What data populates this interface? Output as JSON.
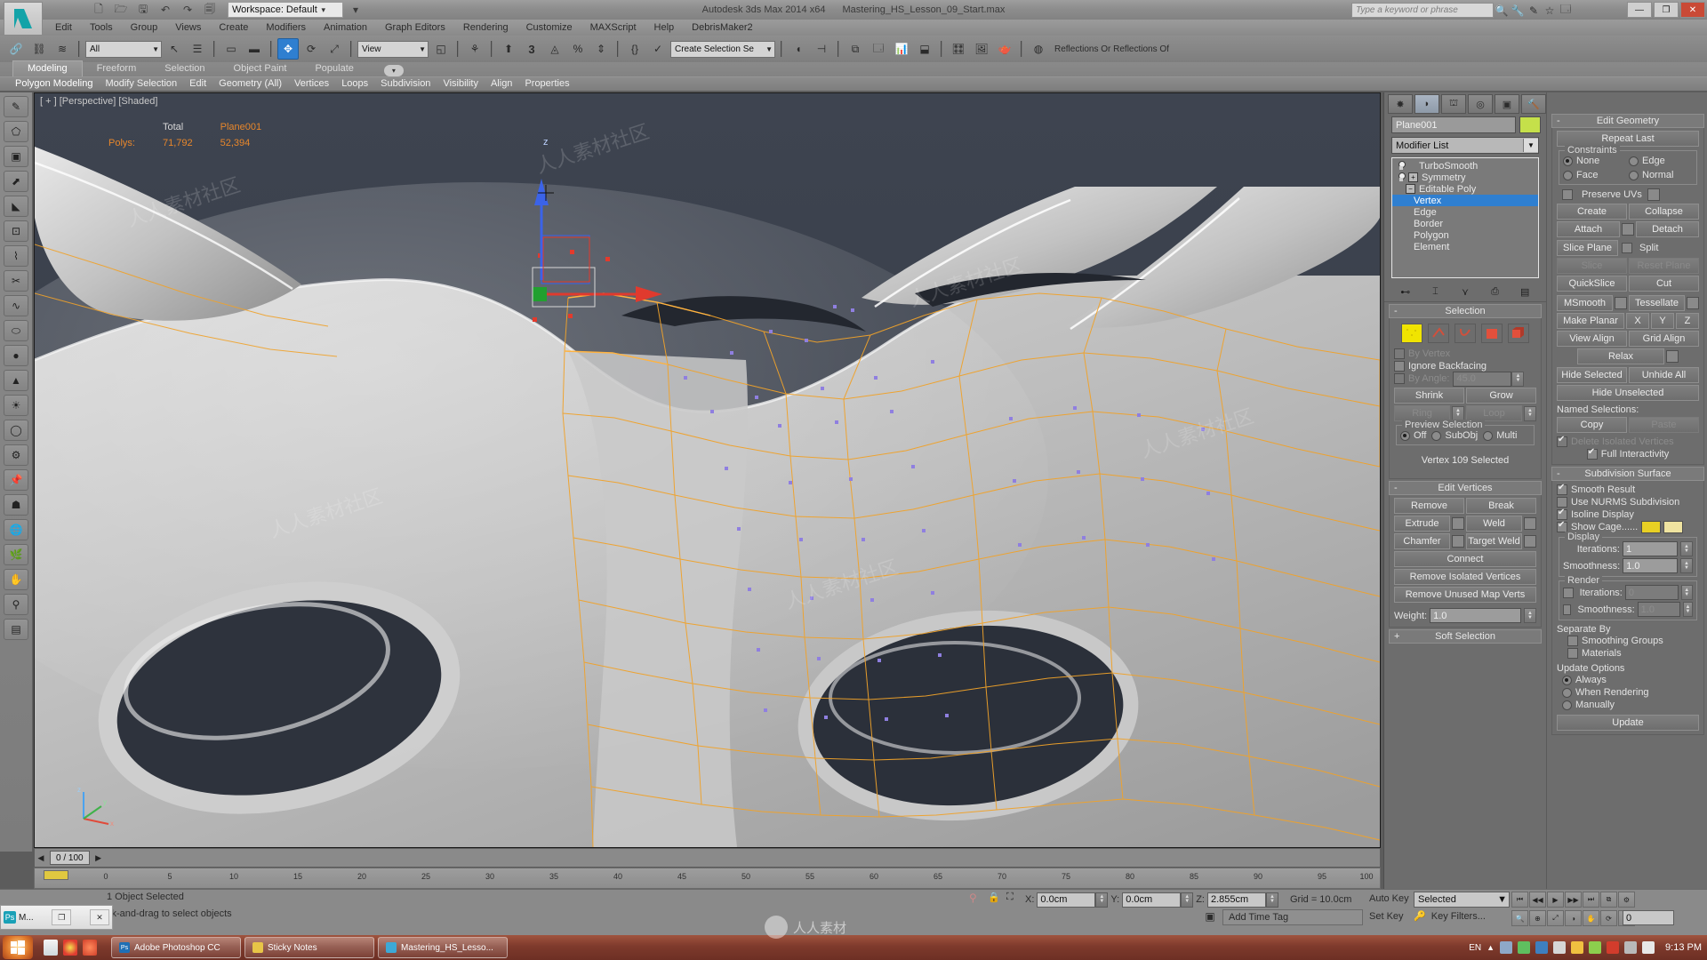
{
  "titlebar": {
    "workspace": "Workspace: Default",
    "app_title": "Autodesk 3ds Max  2014 x64",
    "file_title": "Mastering_HS_Lesson_09_Start.max",
    "search_placeholder": "Type a keyword or phrase",
    "quick_access": [
      "new-icon",
      "open-icon",
      "save-icon",
      "undo-icon",
      "redo-icon",
      "setproject-icon"
    ],
    "title_icons": [
      "binoculars-icon",
      "wrench-icon",
      "pen-icon",
      "star-icon",
      "help-icon"
    ],
    "window_buttons": [
      "minimize",
      "restore",
      "close"
    ],
    "minimize_glyph": "—",
    "restore_glyph": "❐",
    "close_glyph": "✕"
  },
  "menubar": {
    "items": [
      "Edit",
      "Tools",
      "Group",
      "Views",
      "Create",
      "Modifiers",
      "Animation",
      "Graph Editors",
      "Rendering",
      "Customize",
      "MAXScript",
      "Help",
      "DebrisMaker2"
    ]
  },
  "toolbar": {
    "selection_filter": "All",
    "reference_coord": "View",
    "named_selection_sets": "Create Selection Se",
    "snaps_percent": "3",
    "reflections_label": "Reflections Or Reflections Of",
    "icons": [
      "undo-icon",
      "redo-icon",
      "select-link-icon",
      "unlink-icon",
      "bind-spacewarp-icon",
      "select-object-icon",
      "select-by-name-icon",
      "rect-select-region-icon",
      "window-crossing-icon",
      "select-and-move-icon",
      "select-and-rotate-icon",
      "select-and-scale-icon",
      "mirror-icon",
      "align-icon",
      "snap-toggle-icon",
      "angle-snap-icon",
      "percent-snap-icon",
      "spinner-snap-icon",
      "named-selection-icon",
      "curve-editor-icon",
      "schematic-view-icon",
      "material-editor-icon",
      "render-setup-icon",
      "render-frame-window-icon",
      "render-production-icon",
      "render-iterative-icon",
      "activeshade-icon"
    ]
  },
  "ribbon": {
    "tabs": [
      {
        "label": "Modeling",
        "active": true
      },
      {
        "label": "Freeform",
        "active": false
      },
      {
        "label": "Selection",
        "active": false
      },
      {
        "label": "Object Paint",
        "active": false
      },
      {
        "label": "Populate",
        "active": false
      }
    ],
    "subtabs": [
      {
        "label": "Polygon Modeling",
        "active": true
      },
      {
        "label": "Modify Selection",
        "active": false
      },
      {
        "label": "Edit",
        "active": false
      },
      {
        "label": "Geometry (All)",
        "active": false
      },
      {
        "label": "Vertices",
        "active": false
      },
      {
        "label": "Loops",
        "active": false
      },
      {
        "label": "Subdivision",
        "active": false
      },
      {
        "label": "Visibility",
        "active": false
      },
      {
        "label": "Align",
        "active": false
      },
      {
        "label": "Properties",
        "active": false
      }
    ]
  },
  "viewport": {
    "label": "[ + ] [Perspective] [Shaded]",
    "stats": {
      "col_headers": [
        "Total",
        "Plane001"
      ],
      "rows": [
        {
          "name": "Polys:",
          "total": "71,792",
          "object": "52,394"
        }
      ]
    },
    "axis_labels": {
      "x": "x",
      "y": "y",
      "z": "z"
    },
    "gizmo_z_label": "z"
  },
  "command_panel": {
    "tabs": [
      "create-tab",
      "modify-tab",
      "hierarchy-tab",
      "motion-tab",
      "display-tab",
      "utilities-tab"
    ],
    "object_name": "Plane001",
    "object_color": "#c5e04a",
    "modifier_list_label": "Modifier List",
    "stack": [
      {
        "label": "TurboSmooth",
        "type": "modifier",
        "bulb": true,
        "expandable": false,
        "selected": false
      },
      {
        "label": "Symmetry",
        "type": "modifier",
        "bulb": true,
        "expandable": true,
        "selected": false
      },
      {
        "label": "Editable Poly",
        "type": "base",
        "bulb": false,
        "expandable": true,
        "expanded": true,
        "selected": false
      },
      {
        "label": "Vertex",
        "type": "subobject",
        "selected": true
      },
      {
        "label": "Edge",
        "type": "subobject",
        "selected": false
      },
      {
        "label": "Border",
        "type": "subobject",
        "selected": false
      },
      {
        "label": "Polygon",
        "type": "subobject",
        "selected": false
      },
      {
        "label": "Element",
        "type": "subobject",
        "selected": false
      }
    ],
    "stack_tool_icons": [
      "pin-stack-icon",
      "show-end-result-icon",
      "make-unique-icon",
      "remove-modifier-icon",
      "configure-sets-icon"
    ],
    "rollouts": {
      "selection": {
        "title": "Selection",
        "modes": [
          "vertex-mode",
          "edge-mode",
          "border-mode",
          "polygon-mode",
          "element-mode"
        ],
        "active_mode": "vertex-mode",
        "by_vertex": {
          "label": "By Vertex",
          "checked": false,
          "enabled": false
        },
        "ignore_backfacing": {
          "label": "Ignore Backfacing",
          "checked": false,
          "enabled": true
        },
        "by_angle": {
          "label": "By Angle:",
          "checked": false,
          "value": "45.0",
          "enabled": false
        },
        "shrink": "Shrink",
        "grow": "Grow",
        "ring": "Ring",
        "loop": "Loop",
        "preview_selection": {
          "title": "Preview Selection",
          "options": [
            "Off",
            "SubObj",
            "Multi"
          ],
          "selected": "Off"
        },
        "status": "Vertex 109 Selected"
      },
      "edit_vertices": {
        "title": "Edit Vertices",
        "buttons": [
          "Remove",
          "Break",
          "Extrude",
          "Weld",
          "Chamfer",
          "Target Weld",
          "Connect",
          "Remove Isolated Vertices",
          "Remove Unused Map Verts"
        ],
        "weight_label": "Weight:",
        "weight_value": "1.0"
      },
      "soft_selection": {
        "title": "Soft Selection"
      },
      "edit_geometry": {
        "title": "Edit Geometry",
        "repeat_last": "Repeat Last",
        "constraints": {
          "title": "Constraints",
          "options": [
            "None",
            "Edge",
            "Face",
            "Normal"
          ],
          "selected": "None"
        },
        "preserve_uvs": {
          "label": "Preserve UVs",
          "checked": false
        },
        "create": "Create",
        "collapse": "Collapse",
        "attach": "Attach",
        "detach": "Detach",
        "slice_plane": "Slice Plane",
        "split": {
          "label": "Split",
          "checked": false
        },
        "slice": "Slice",
        "reset_plane": "Reset Plane",
        "quickslice": "QuickSlice",
        "cut": "Cut",
        "msmooth": "MSmooth",
        "tessellate": "Tessellate",
        "make_planar": "Make Planar",
        "axes": [
          "X",
          "Y",
          "Z"
        ],
        "view_align": "View Align",
        "grid_align": "Grid Align",
        "relax": "Relax",
        "hide_selected": "Hide Selected",
        "unhide_all": "Unhide All",
        "hide_unselected": "Hide Unselected",
        "named_selections_label": "Named Selections:",
        "copy": "Copy",
        "paste": "Paste",
        "delete_isolated": {
          "label": "Delete Isolated Vertices",
          "checked": true,
          "enabled": false
        },
        "full_interactivity": {
          "label": "Full Interactivity",
          "checked": true
        }
      },
      "subdivision_surface": {
        "title": "Subdivision Surface",
        "smooth_result": {
          "label": "Smooth Result",
          "checked": true
        },
        "use_nurms": {
          "label": "Use NURMS Subdivision",
          "checked": false
        },
        "isoline_display": {
          "label": "Isoline Display",
          "checked": true
        },
        "show_cage": {
          "label": "Show Cage......",
          "checked": true,
          "color1": "#e8d024",
          "color2": "#efe3a0"
        },
        "display": {
          "title": "Display",
          "iterations_label": "Iterations:",
          "iterations_value": "1",
          "smoothness_label": "Smoothness:",
          "smoothness_value": "1.0"
        },
        "render": {
          "title": "Render",
          "iterations_label": "Iterations:",
          "iterations_value": "0",
          "smoothness_label": "Smoothness:",
          "smoothness_value": "1.0"
        },
        "separate_by_label": "Separate By",
        "smoothing_groups": {
          "label": "Smoothing Groups",
          "checked": false
        },
        "materials": {
          "label": "Materials",
          "checked": false
        },
        "update_options": {
          "title": "Update Options",
          "options": [
            "Always",
            "When Rendering",
            "Manually"
          ],
          "selected": "Always"
        },
        "update_button": "Update"
      }
    }
  },
  "timeline": {
    "frame_display": "0 / 100",
    "ticks": [
      "0",
      "5",
      "10",
      "15",
      "20",
      "25",
      "30",
      "35",
      "40",
      "45",
      "50",
      "55",
      "60",
      "65",
      "70",
      "75",
      "80",
      "85",
      "90",
      "95",
      "100"
    ]
  },
  "statusbar": {
    "message": "1 Object Selected",
    "prompt": "ck-and-drag to select objects",
    "coords": [
      {
        "label": "X:",
        "value": "0.0cm"
      },
      {
        "label": "Y:",
        "value": "0.0cm"
      },
      {
        "label": "Z:",
        "value": "2.855cm"
      }
    ],
    "grid": "Grid = 10.0cm",
    "add_time_tag": "Add Time Tag",
    "auto_key": "Auto Key",
    "set_key": "Set Key",
    "selected_combo": "Selected",
    "key_filters": "Key Filters...",
    "frame_value": "0"
  },
  "taskbar": {
    "items": [
      {
        "label": "Adobe Photoshop CC",
        "icon_color": "#1f6fb5",
        "icon_text": "Ps"
      },
      {
        "label": "Sticky Notes",
        "icon_color": "#e8c547",
        "icon_text": ""
      },
      {
        "label": "Mastering_HS_Lesso...",
        "icon_color": "#3da9d6",
        "icon_text": ""
      }
    ],
    "lang": "EN",
    "clock": "9:13 PM",
    "tray_icons": [
      "network-icon",
      "action-center-icon",
      "display-icon",
      "dropbox-icon",
      "shield-icon",
      "nvidia-icon",
      "antivirus-icon",
      "usb-icon",
      "volume-icon"
    ]
  },
  "photoshop_mini": {
    "title": "M...",
    "restore_glyph": "❐",
    "close_glyph": "✕"
  },
  "watermark": {
    "text": "人人素材社区",
    "brand": "人人素材"
  }
}
